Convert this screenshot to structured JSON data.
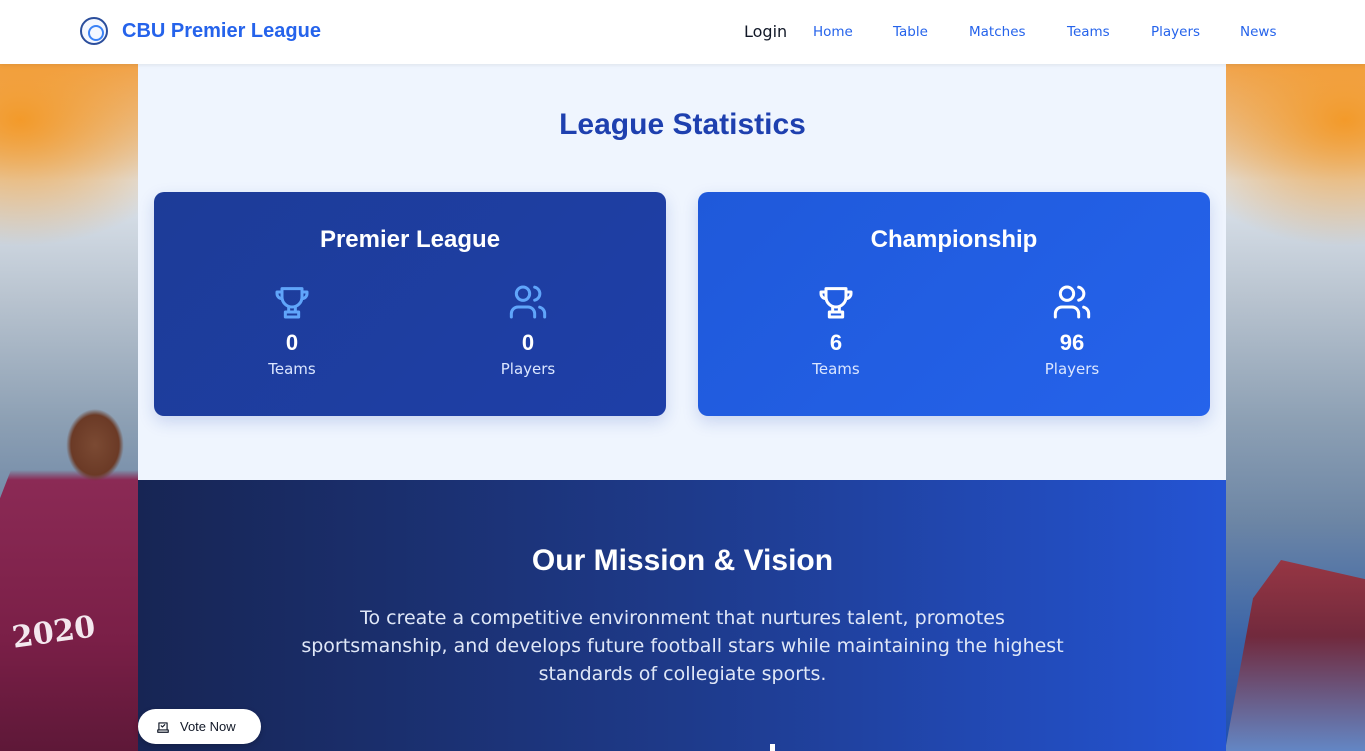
{
  "brand": {
    "name": "CBU Premier League",
    "logo_icon": "cbu-logo-icon"
  },
  "nav": {
    "login": "Login",
    "links": [
      "Home",
      "Table",
      "Matches",
      "Teams",
      "Players",
      "News"
    ]
  },
  "stats": {
    "title": "League Statistics",
    "cards": [
      {
        "title": "Premier League",
        "teams_value": "0",
        "teams_label": "Teams",
        "players_value": "0",
        "players_label": "Players"
      },
      {
        "title": "Championship",
        "teams_value": "6",
        "teams_label": "Teams",
        "players_value": "96",
        "players_label": "Players"
      }
    ]
  },
  "mission": {
    "title": "Our Mission & Vision",
    "text": "To create a competitive environment that nurtures talent, promotes sportsmanship, and develops future football stars while maintaining the highest standards of collegiate sports."
  },
  "background": {
    "jersey_text": "2020"
  },
  "vote": {
    "label": "Vote Now",
    "icon": "vote-box-icon"
  },
  "colors": {
    "accent": "#2563eb",
    "title": "#1e40af",
    "panel": "#eff5fe",
    "mission_dark": "#172554"
  }
}
